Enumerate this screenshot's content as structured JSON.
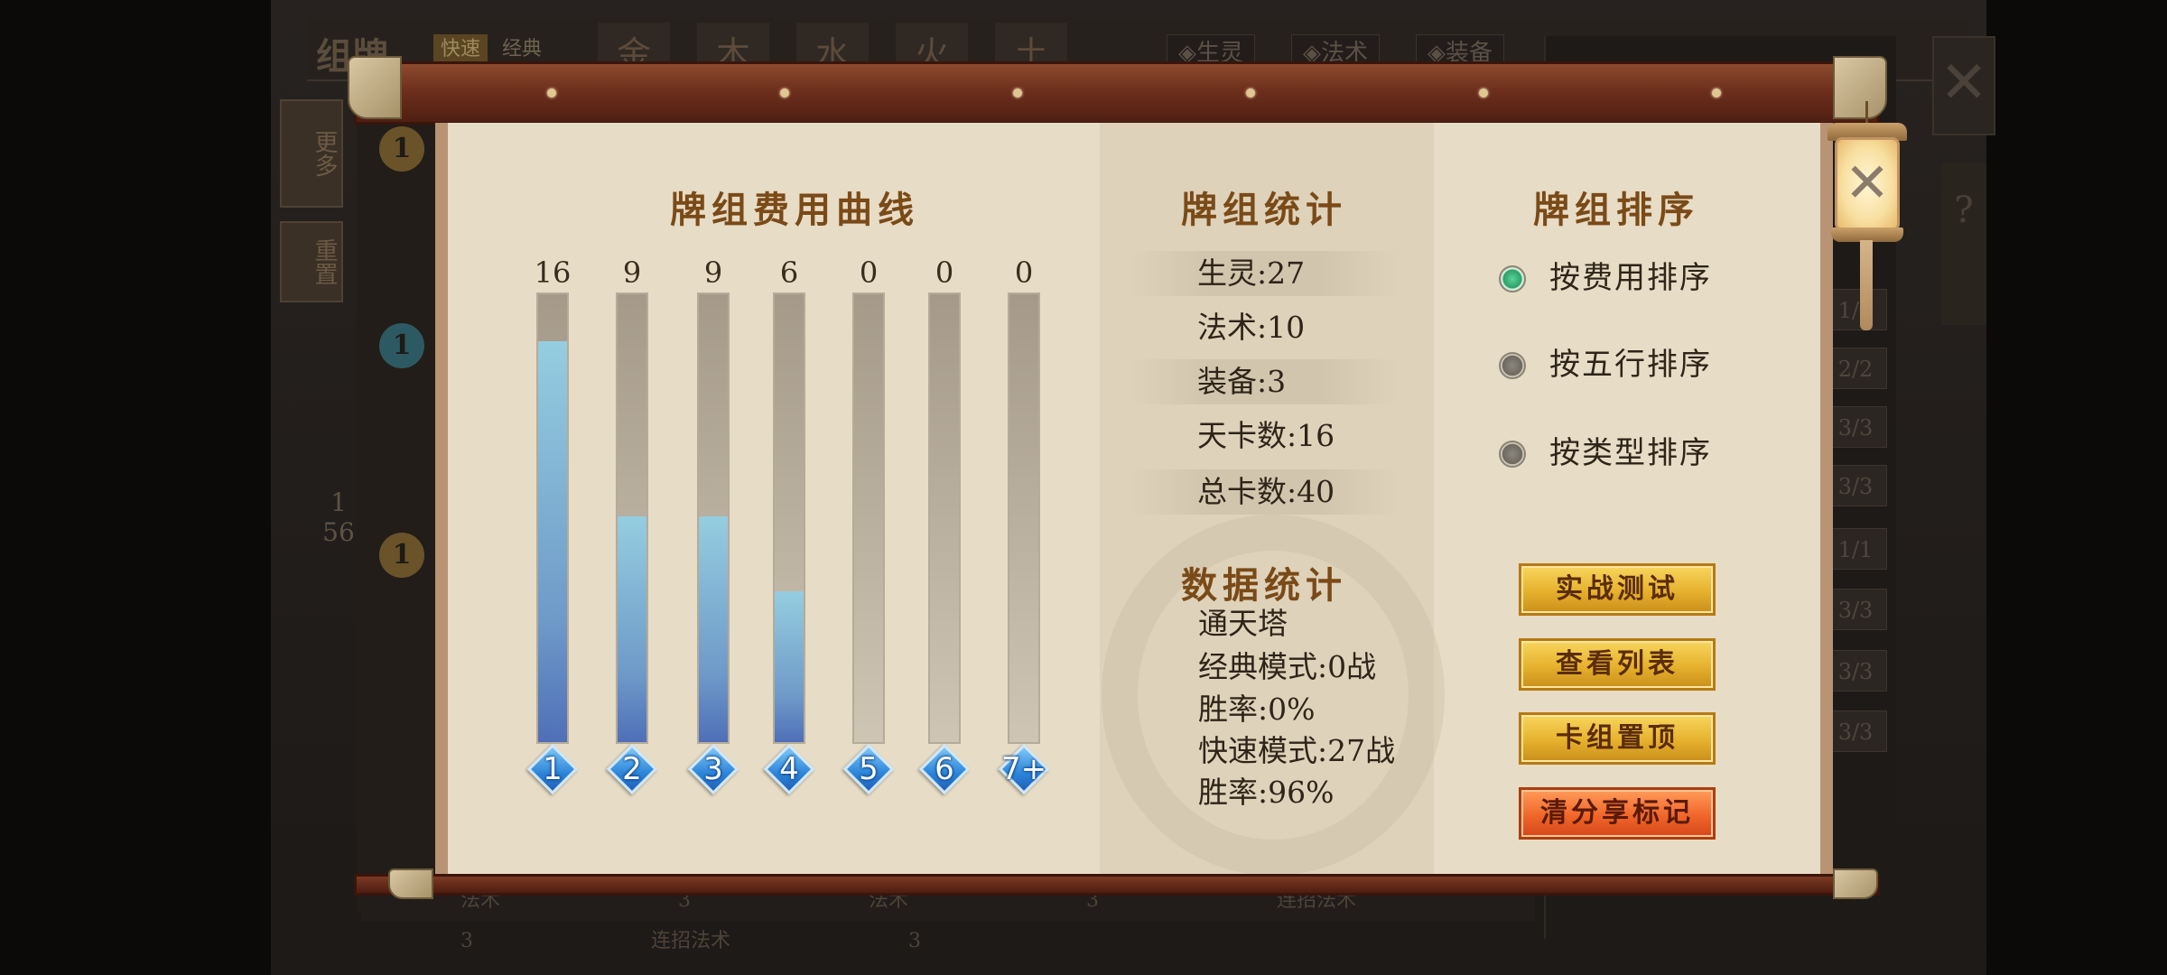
{
  "background": {
    "title": "组牌",
    "mode_tabs": [
      "快速",
      "经典"
    ],
    "elements": [
      "金",
      "木",
      "水",
      "火",
      "土"
    ],
    "filters": [
      "◈生灵",
      "◈法术",
      "◈装备"
    ],
    "side_buttons": [
      "更多",
      "重置"
    ],
    "cost_badges": [
      "1",
      "1",
      "1"
    ],
    "counter_top": "1",
    "counter_bottom": "56",
    "card_counts": [
      "1/1",
      "2/2",
      "3/3",
      "3/3",
      "1/1",
      "3/3",
      "3/3",
      "3/3"
    ],
    "bottom_row": "法术 3 法术 3 连招法术 3 连招法术 3",
    "close_glyph": "✕",
    "help_glyph": "?"
  },
  "dialog": {
    "cost_curve": {
      "title": "牌组费用曲线"
    },
    "deck_stats": {
      "title": "牌组统计",
      "rows": [
        "生灵:27",
        "法术:10",
        "装备:3",
        "天卡数:16",
        "总卡数:40"
      ]
    },
    "data_stats": {
      "title": "数据统计",
      "lines": [
        "通天塔",
        "经典模式:0战",
        "胜率:0%",
        "快速模式:27战",
        "胜率:96%"
      ]
    },
    "sort": {
      "title": "牌组排序",
      "options": [
        {
          "label": "按费用排序",
          "selected": true
        },
        {
          "label": "按五行排序",
          "selected": false
        },
        {
          "label": "按类型排序",
          "selected": false
        }
      ]
    },
    "buttons": {
      "test": "实战测试",
      "view_list": "查看列表",
      "pin_deck": "卡组置顶",
      "clear_share": "清分享标记"
    },
    "close_glyph": "✕"
  },
  "chart_data": {
    "type": "bar",
    "title": "牌组费用曲线",
    "categories": [
      "1",
      "2",
      "3",
      "4",
      "5",
      "6",
      "7+"
    ],
    "values": [
      16,
      9,
      9,
      6,
      0,
      0,
      0
    ],
    "ylim": [
      0,
      17
    ],
    "xlabel": "",
    "ylabel": ""
  },
  "colors": {
    "bar_fill_top": "#95cde0",
    "bar_fill_bottom": "#4f6fb8",
    "title_brown": "#7a4a17",
    "button_gold": "#e6b12d",
    "button_red": "#f0662a",
    "radio_selected": "#2ca06a"
  }
}
